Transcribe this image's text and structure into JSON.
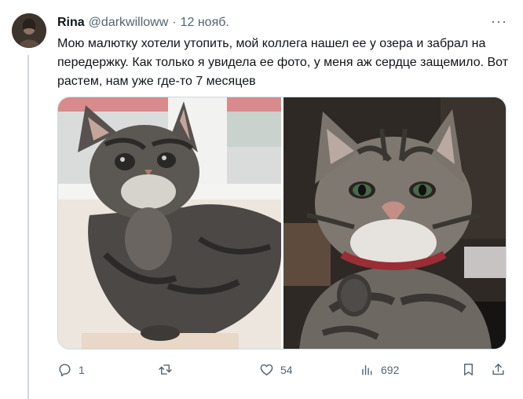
{
  "tweet": {
    "author_name": "Rina",
    "handle": "@darkwilloww",
    "separator": "·",
    "date": "12 нояб.",
    "more": "···",
    "text": "Мою малютку хотели утопить, мой коллега нашел ее у озера и забрал на передержку. Как только я увидела ее фото, у меня аж сердце защемило. Вот растем, нам уже где-то 7 месяцев"
  },
  "actions": {
    "reply_count": "1",
    "retweet_count": "",
    "like_count": "54",
    "views_count": "692"
  },
  "icons": {
    "reply": "reply-icon",
    "retweet": "retweet-icon",
    "like": "heart-icon",
    "views": "views-icon",
    "bookmark": "bookmark-icon",
    "share": "share-icon"
  },
  "colors": {
    "text": "#0f1419",
    "secondary": "#536471",
    "border": "#cfd9de"
  }
}
